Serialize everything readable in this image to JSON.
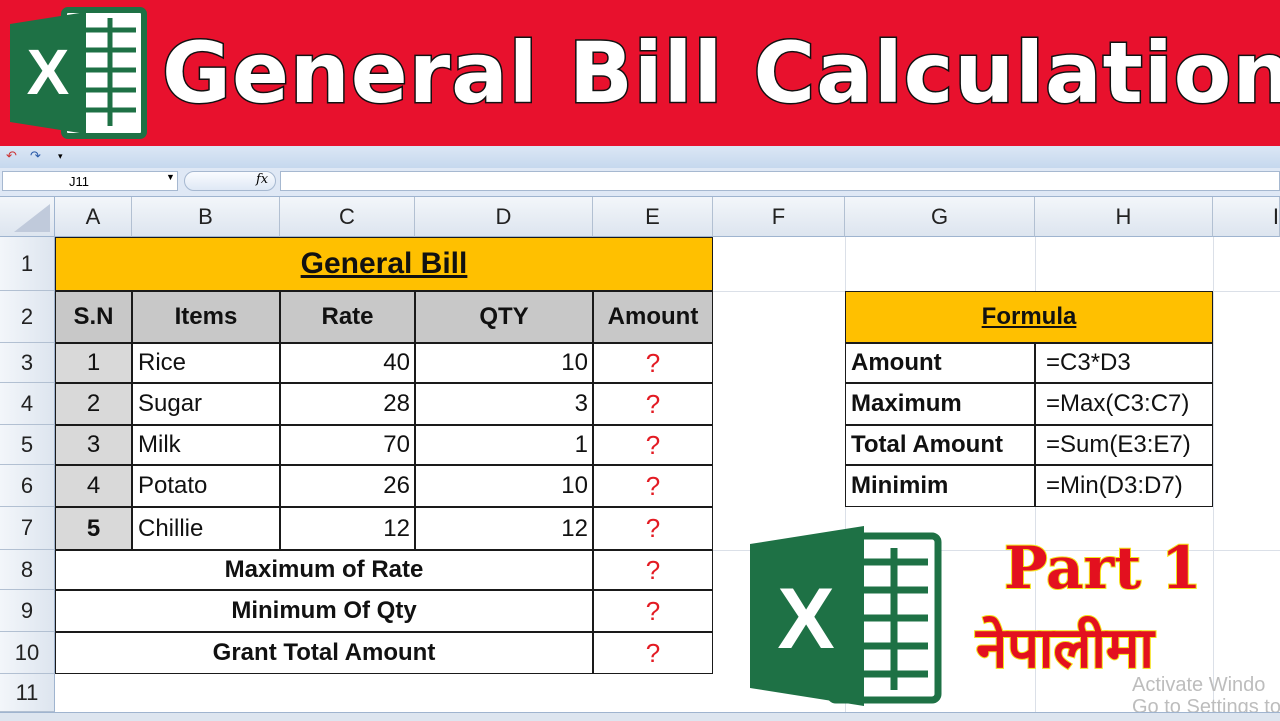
{
  "banner": {
    "title": "General Bill Calculation",
    "logo_letter": "X",
    "bg_color": "#e8112d"
  },
  "formula_bar": {
    "name_box": "J11",
    "fx_label": "fx",
    "formula": ""
  },
  "columns": [
    "A",
    "B",
    "C",
    "D",
    "E",
    "F",
    "G",
    "H",
    "I"
  ],
  "rows": [
    "1",
    "2",
    "3",
    "4",
    "5",
    "6",
    "7",
    "8",
    "9",
    "10",
    "11"
  ],
  "bill": {
    "title": "General Bill",
    "headers": [
      "S.N",
      "Items",
      "Rate",
      "QTY",
      "Amount"
    ],
    "items": [
      {
        "sn": "1",
        "item": "Rice",
        "rate": "40",
        "qty": "10",
        "amount": "?"
      },
      {
        "sn": "2",
        "item": "Sugar",
        "rate": "28",
        "qty": "3",
        "amount": "?"
      },
      {
        "sn": "3",
        "item": "Milk",
        "rate": "70",
        "qty": "1",
        "amount": "?"
      },
      {
        "sn": "4",
        "item": "Potato",
        "rate": "26",
        "qty": "10",
        "amount": "?"
      },
      {
        "sn": "5",
        "item": "Chillie",
        "rate": "12",
        "qty": "12",
        "amount": "?"
      }
    ],
    "summary": [
      {
        "label": "Maximum of Rate",
        "value": "?"
      },
      {
        "label": "Minimum Of Qty",
        "value": "?"
      },
      {
        "label": "Grant Total Amount",
        "value": "?"
      }
    ]
  },
  "formula_table": {
    "title": "Formula",
    "rows": [
      {
        "label": "Amount",
        "formula": "=C3*D3"
      },
      {
        "label": "Maximum",
        "formula": "=Max(C3:C7)"
      },
      {
        "label": "Total Amount",
        "formula": "=Sum(E3:E7)"
      },
      {
        "label": "Minimim",
        "formula": "=Min(D3:D7)"
      }
    ]
  },
  "overlay": {
    "part": "Part 1",
    "nepali": "नेपालीमा",
    "watermark_line1": "Activate Windo",
    "watermark_line2": "Go to Settings to ac"
  },
  "colors": {
    "header_yellow": "#ffc000",
    "header_gray": "#c8c8c8",
    "sn_gray": "#d9d9d9",
    "question_red": "#e31b23",
    "excel_green": "#1e7145"
  }
}
